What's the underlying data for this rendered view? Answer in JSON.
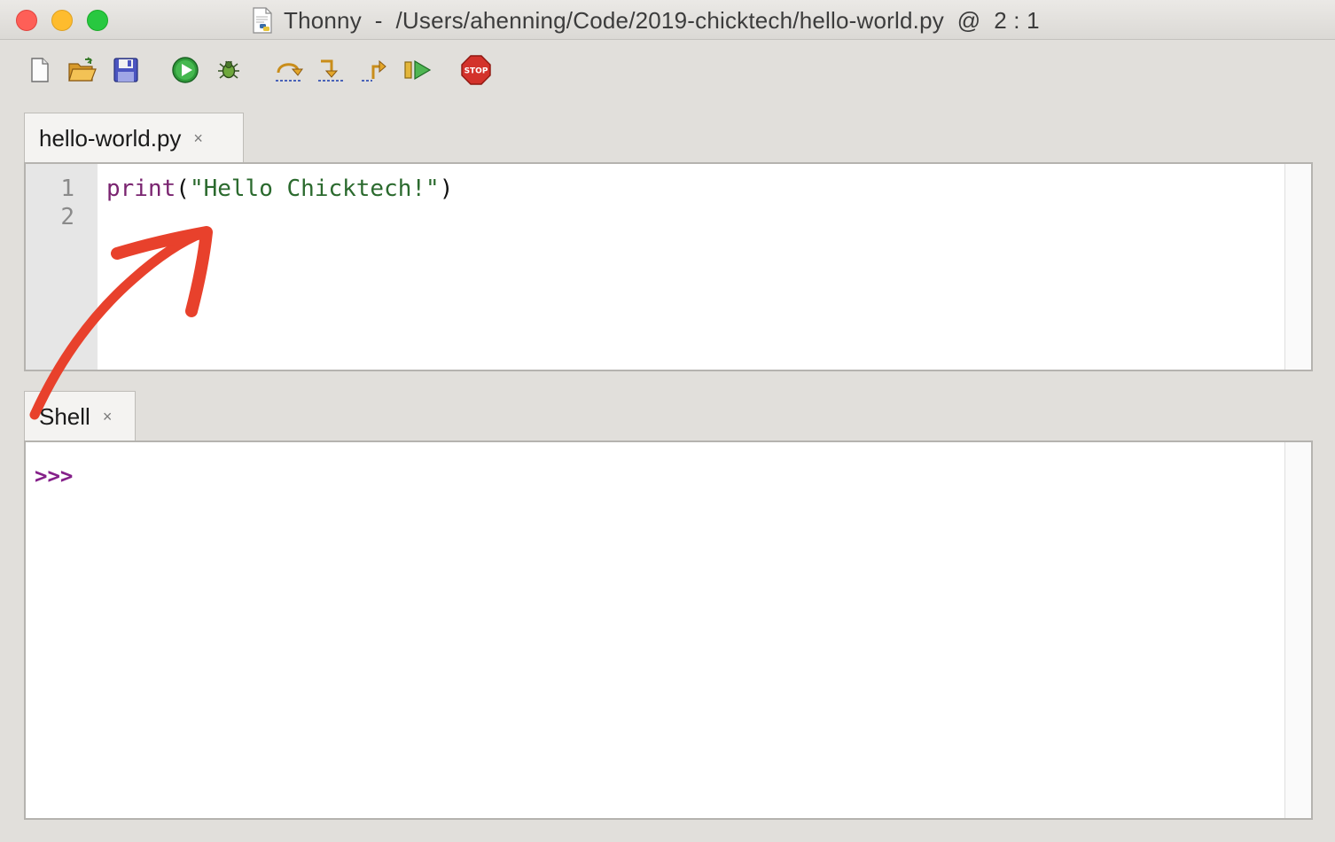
{
  "window": {
    "title": "Thonny  -  /Users/ahenning/Code/2019-chicktech/hello-world.py  @  2 : 1"
  },
  "toolbar": {
    "buttons": [
      {
        "icon": "new-file-icon"
      },
      {
        "icon": "open-folder-icon"
      },
      {
        "icon": "save-icon"
      },
      {
        "icon": "run-icon"
      },
      {
        "icon": "debug-icon"
      },
      {
        "icon": "step-over-icon"
      },
      {
        "icon": "step-into-icon"
      },
      {
        "icon": "step-out-icon"
      },
      {
        "icon": "resume-icon"
      },
      {
        "icon": "stop-icon",
        "label": "STOP"
      }
    ]
  },
  "editor": {
    "tab_label": "hello-world.py",
    "close_glyph": "×",
    "line_numbers": [
      "1",
      "2"
    ],
    "code": {
      "fn": "print",
      "open": "(",
      "string": "\"Hello Chicktech!\"",
      "close": ")"
    }
  },
  "shell": {
    "tab_label": "Shell",
    "close_glyph": "×",
    "prompt": ">>>"
  },
  "colors": {
    "annotation_arrow": "#e8412c",
    "keyword": "#7a2470",
    "string": "#2b6a2e",
    "prompt": "#85208a"
  }
}
